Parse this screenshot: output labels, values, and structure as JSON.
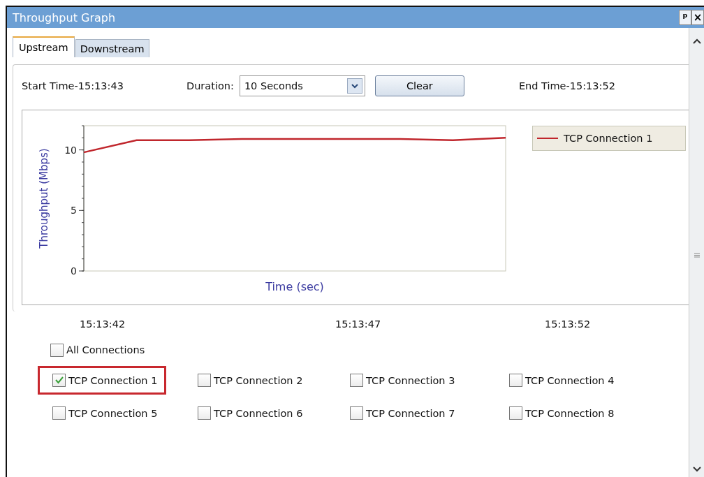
{
  "window": {
    "title": "Throughput Graph",
    "buttons": [
      "ᵖ",
      "×"
    ]
  },
  "tabs": [
    {
      "label": "Upstream",
      "selected": true
    },
    {
      "label": "Downstream",
      "selected": false
    }
  ],
  "toolbar": {
    "start_time": "Start Time-15:13:43",
    "duration_label": "Duration:",
    "duration_value": "10 Seconds",
    "clear_button": "Clear",
    "end_time": "End Time-15:13:52"
  },
  "chart": {
    "chart_data": {
      "type": "line",
      "xlabel": "Time (sec)",
      "ylabel": "Throughput (Mbps)",
      "ylim": [
        0,
        12
      ],
      "yticks": [
        0,
        5,
        10
      ],
      "series": [
        {
          "name": "TCP Connection 1",
          "color": "#c0262c",
          "values": [
            9.8,
            10.8,
            10.8,
            10.9,
            10.9,
            10.9,
            10.9,
            10.8,
            11.0
          ]
        }
      ]
    }
  },
  "time_labels": [
    "15:13:42",
    "15:13:47",
    "15:13:52"
  ],
  "all_connections": {
    "label": "All Connections",
    "checked": false
  },
  "connections": [
    {
      "label": "TCP Connection 1",
      "checked": true,
      "highlighted": true
    },
    {
      "label": "TCP Connection 2",
      "checked": false,
      "highlighted": false
    },
    {
      "label": "TCP Connection 3",
      "checked": false,
      "highlighted": false
    },
    {
      "label": "TCP Connection 4",
      "checked": false,
      "highlighted": false
    },
    {
      "label": "TCP Connection 5",
      "checked": false,
      "highlighted": false
    },
    {
      "label": "TCP Connection 6",
      "checked": false,
      "highlighted": false
    },
    {
      "label": "TCP Connection 7",
      "checked": false,
      "highlighted": false
    },
    {
      "label": "TCP Connection 8",
      "checked": false,
      "highlighted": false
    }
  ]
}
